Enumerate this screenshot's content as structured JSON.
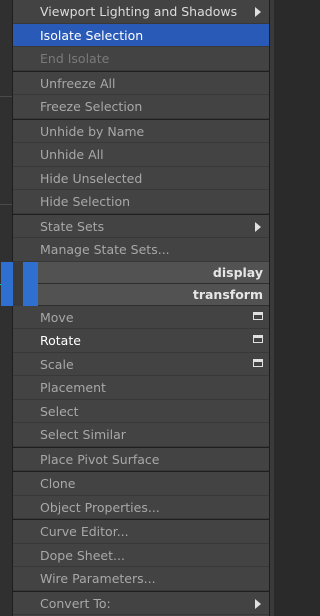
{
  "menu": {
    "top_items": [
      {
        "label": "Viewport Lighting and Shadows",
        "submenu": true
      },
      {
        "label": "Isolate Selection",
        "state": "highlighted"
      },
      {
        "label": "End Isolate",
        "state": "disabled"
      },
      {
        "label": "Unfreeze All"
      },
      {
        "label": "Freeze Selection"
      },
      {
        "label": "Unhide by Name"
      },
      {
        "label": "Unhide All"
      },
      {
        "label": "Hide Unselected"
      },
      {
        "label": "Hide Selection"
      },
      {
        "label": "State Sets",
        "submenu": true
      },
      {
        "label": "Manage State Sets..."
      }
    ],
    "headers": {
      "display": "display",
      "transform": "transform"
    },
    "bottom_items": [
      {
        "label": "Move",
        "settings_box": true
      },
      {
        "label": "Rotate",
        "settings_box": true
      },
      {
        "label": "Scale",
        "settings_box": true
      },
      {
        "label": "Placement"
      },
      {
        "label": "Select"
      },
      {
        "label": "Select Similar"
      },
      {
        "label": "Place Pivot Surface"
      },
      {
        "label": "Clone"
      },
      {
        "label": "Object Properties..."
      },
      {
        "label": "Curve Editor..."
      },
      {
        "label": "Dope Sheet..."
      },
      {
        "label": "Wire Parameters..."
      },
      {
        "label": "Convert To:",
        "submenu": true
      }
    ]
  },
  "colors": {
    "highlight": "#2a5ab8",
    "menu_bg": "#434343",
    "quad_accent": "#2f6fd0"
  }
}
